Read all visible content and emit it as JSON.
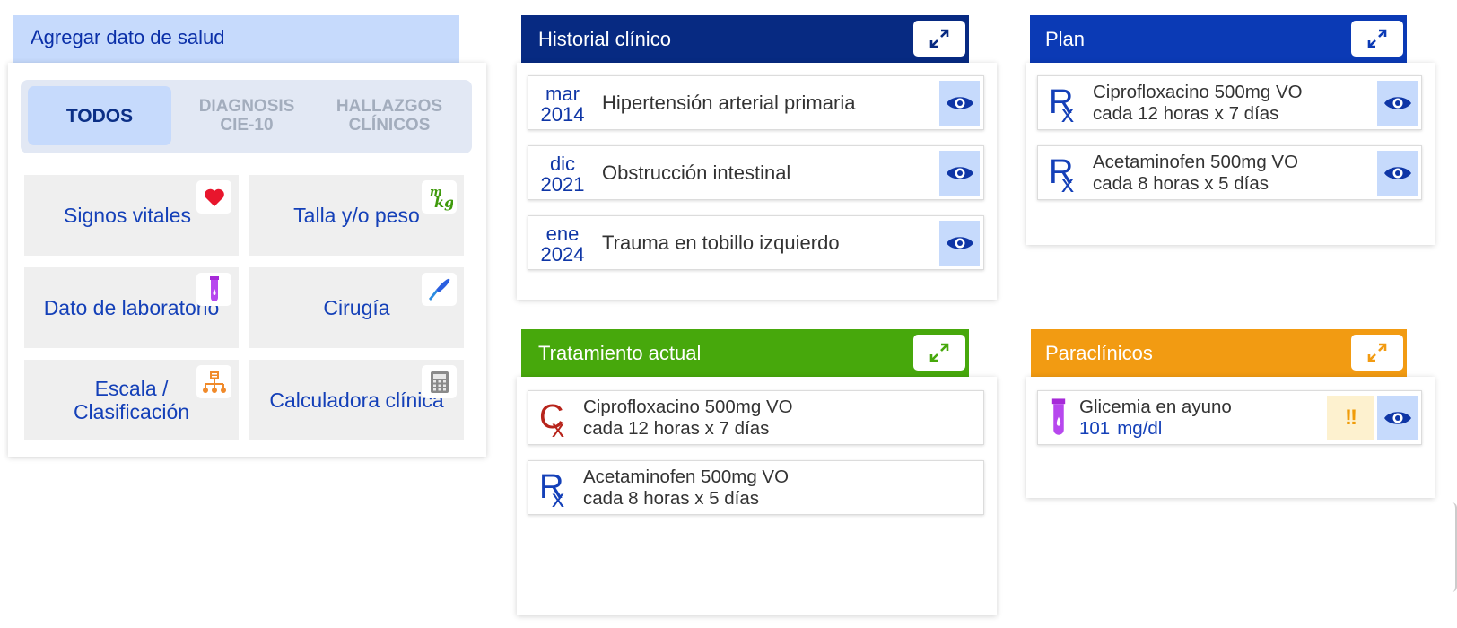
{
  "colors": {
    "historial": "#072a82",
    "plan": "#0b3ab5",
    "tratamiento": "#47a80c",
    "paraclinicos": "#f29b12",
    "accent_light": "#c6dafc",
    "link_blue": "#1440b8",
    "suspended_red": "#b7241b"
  },
  "add_health": {
    "title": "Agregar dato de salud",
    "tabs": [
      {
        "label": "TODOS",
        "active": true
      },
      {
        "label": "DIAGNOSIS CIE-10",
        "active": false
      },
      {
        "label": "HALLAZGOS CLÍNICOS",
        "active": false
      }
    ],
    "tiles": [
      {
        "label": "Signos vitales",
        "icon": "heart-icon"
      },
      {
        "label": "Talla y/o peso",
        "icon": "mkg-icon"
      },
      {
        "label": "Dato de laboratorio",
        "icon": "test-tube-icon"
      },
      {
        "label": "Cirugía",
        "icon": "scalpel-icon"
      },
      {
        "label": "Escala / Clasificación",
        "icon": "hierarchy-icon"
      },
      {
        "label": "Calculadora clínica",
        "icon": "calculator-icon"
      }
    ]
  },
  "historial": {
    "title": "Historial clínico",
    "entries": [
      {
        "month": "mar",
        "year": "2014",
        "text": "Hipertensión arterial primaria"
      },
      {
        "month": "dic",
        "year": "2021",
        "text": "Obstrucción intestinal"
      },
      {
        "month": "ene",
        "year": "2024",
        "text": "Trauma en tobillo izquierdo"
      }
    ]
  },
  "plan": {
    "title": "Plan",
    "items": [
      {
        "line1": "Ciprofloxacino 500mg VO",
        "line2": "cada 12 horas x 7 días",
        "icon": "rx-icon"
      },
      {
        "line1": "Acetaminofen 500mg VO",
        "line2": "cada 8 horas x 5 días",
        "icon": "rx-icon"
      }
    ]
  },
  "tratamiento": {
    "title": "Tratamiento actual",
    "items": [
      {
        "line1": "Ciprofloxacino 500mg VO",
        "line2": "cada 12 horas x 7 días",
        "icon": "cx-icon"
      },
      {
        "line1": "Acetaminofen 500mg VO",
        "line2": "cada 8 horas x 5 días",
        "icon": "rx-icon"
      }
    ]
  },
  "paraclinicos": {
    "title": "Paraclínicos",
    "items": [
      {
        "name": "Glicemia en ayuno",
        "value": "101",
        "unit": "mg/dl",
        "alert": "!!",
        "icon": "test-tube-icon"
      }
    ]
  }
}
